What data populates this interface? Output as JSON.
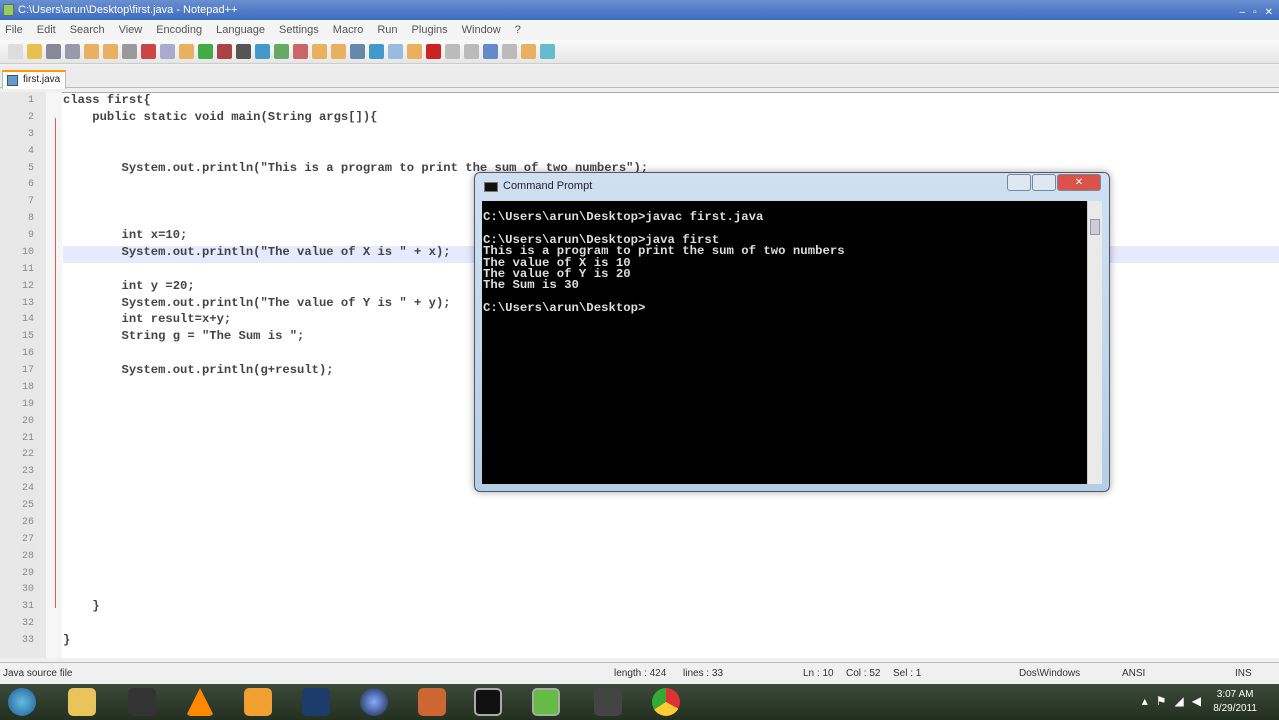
{
  "window": {
    "title": "C:\\Users\\arun\\Desktop\\first.java - Notepad++",
    "controls": [
      "‒",
      "▫",
      "✕"
    ]
  },
  "menu": [
    "File",
    "Edit",
    "Search",
    "View",
    "Encoding",
    "Language",
    "Settings",
    "Macro",
    "Run",
    "Plugins",
    "Window",
    "?"
  ],
  "tab": {
    "label": "first.java"
  },
  "editor": {
    "lines": [
      "class first{",
      "    public static void main(String args[]){",
      "",
      "",
      "        System.out.println(\"This is a program to print the sum of two numbers\");",
      "",
      "",
      "",
      "        int x=10;",
      "        System.out.println(\"The value of X is \" + x);",
      "",
      "        int y =20;",
      "        System.out.println(\"The value of Y is \" + y);",
      "        int result=x+y;",
      "        String g = \"The Sum is \";",
      "",
      "        System.out.println(g+result);",
      "",
      "",
      "",
      "",
      "",
      "",
      "",
      "",
      "",
      "",
      "",
      "",
      "",
      "    }",
      "",
      "}"
    ]
  },
  "status": {
    "filetype": "Java source file",
    "length": "length : 424",
    "lines": "lines : 33",
    "ln": "Ln : 10",
    "col": "Col : 52",
    "sel": "Sel : 1",
    "eol": "Dos\\Windows",
    "encoding": "ANSI",
    "mode": "INS"
  },
  "cmd": {
    "title": "Command Prompt",
    "output": "C:\\Users\\arun\\Desktop>javac first.java\n\nC:\\Users\\arun\\Desktop>java first\nThis is a program to print the sum of two numbers\nThe value of X is 10\nThe value of Y is 20\nThe Sum is 30\n\nC:\\Users\\arun\\Desktop>"
  },
  "taskbar": {
    "time": "3:07 AM",
    "date": "8/29/2011"
  }
}
